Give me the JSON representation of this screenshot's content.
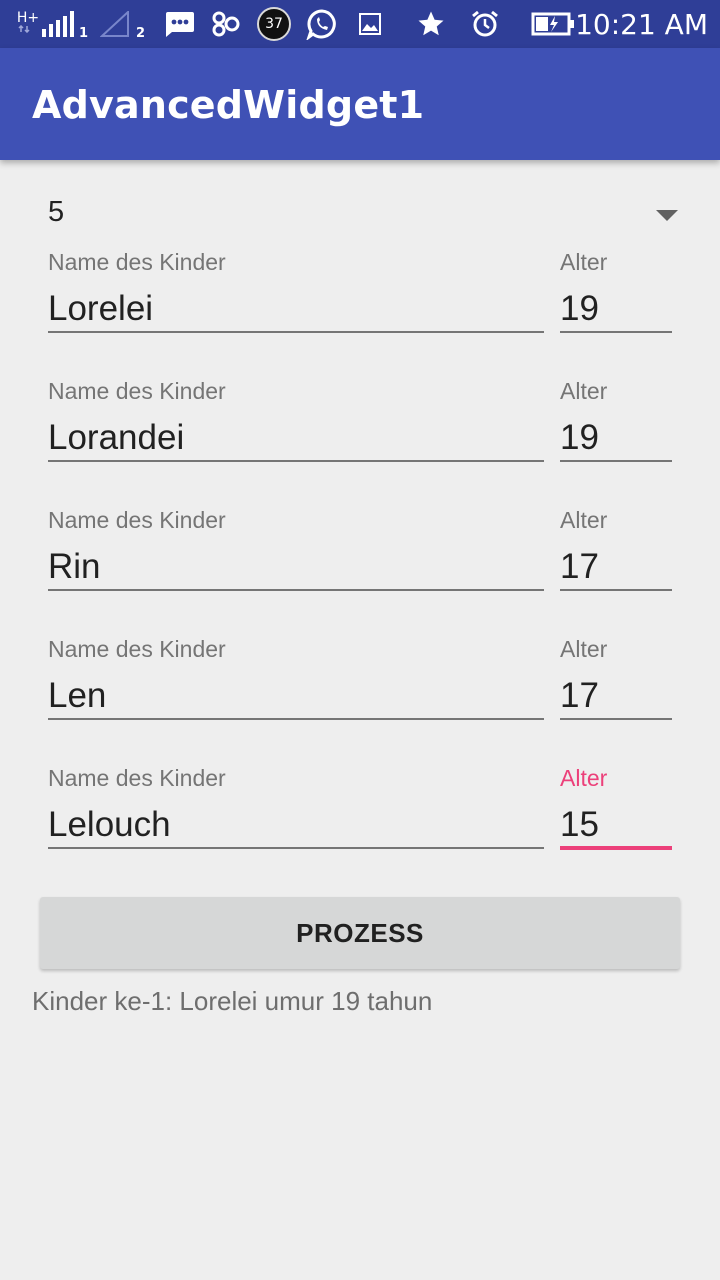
{
  "status_bar": {
    "network": "H+",
    "sim1": "1",
    "sim2": "2",
    "notification_count": "37",
    "time": "10:21 AM",
    "icons": [
      "signal-icon",
      "signal-empty-icon",
      "message-icon",
      "link-icon",
      "count-badge-icon",
      "whatsapp-icon",
      "image-icon",
      "star-icon",
      "alarm-icon",
      "battery-charging-icon"
    ]
  },
  "app_bar": {
    "title": "AdvancedWidget1"
  },
  "spinner": {
    "selected": "5"
  },
  "children": [
    {
      "name_label": "Name des Kinder",
      "name": "Lorelei",
      "age_label": "Alter",
      "age": "19"
    },
    {
      "name_label": "Name des Kinder",
      "name": "Lorandei",
      "age_label": "Alter",
      "age": "19"
    },
    {
      "name_label": "Name des Kinder",
      "name": "Rin",
      "age_label": "Alter",
      "age": "17"
    },
    {
      "name_label": "Name des Kinder",
      "name": "Len",
      "age_label": "Alter",
      "age": "17"
    },
    {
      "name_label": "Name des Kinder",
      "name": "Lelouch",
      "age_label": "Alter",
      "age": "15"
    }
  ],
  "process_button": {
    "label": "PROZESS"
  },
  "result": {
    "text": "Kinder ke-1: Lorelei umur 19 tahun"
  },
  "colors": {
    "primary": "#3f51b5",
    "primary_dark": "#2f3e97",
    "accent": "#ec407a"
  }
}
